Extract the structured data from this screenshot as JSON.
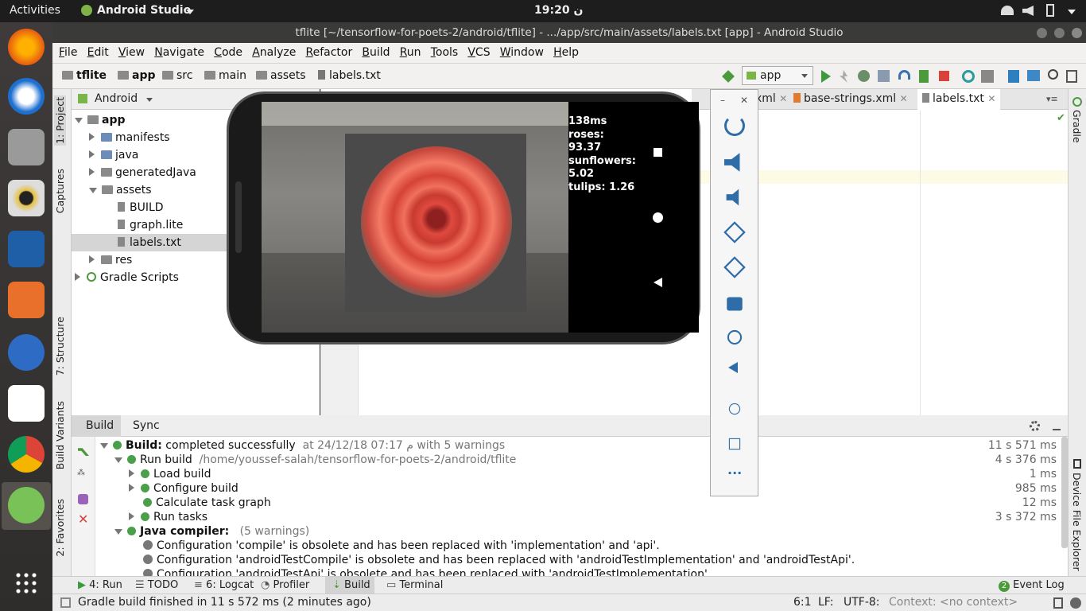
{
  "topbar": {
    "activities": "Activities",
    "app_name": "Android Studio",
    "clock": "ن 19:20"
  },
  "window": {
    "title": "tflite [~/tensorflow-for-poets-2/android/tflite] - .../app/src/main/assets/labels.txt [app] - Android Studio"
  },
  "menu": [
    "File",
    "Edit",
    "View",
    "Navigate",
    "Code",
    "Analyze",
    "Refactor",
    "Build",
    "Run",
    "Tools",
    "VCS",
    "Window",
    "Help"
  ],
  "breadcrumb": [
    "tflite",
    "app",
    "src",
    "main",
    "assets",
    "labels.txt"
  ],
  "run_config": "app",
  "left_tabs": [
    "1: Project",
    "Captures",
    "7: Structure",
    "Build Variants",
    "2: Favorites"
  ],
  "right_tabs": [
    "Gradle",
    "Device File Explorer"
  ],
  "project": {
    "view": "Android",
    "tree": [
      {
        "label": "app",
        "level": 0,
        "bold": true
      },
      {
        "label": "manifests",
        "level": 1
      },
      {
        "label": "java",
        "level": 1
      },
      {
        "label": "generatedJava",
        "level": 1
      },
      {
        "label": "assets",
        "level": 1
      },
      {
        "label": "BUILD",
        "level": 2
      },
      {
        "label": "graph.lite",
        "level": 2
      },
      {
        "label": "labels.txt",
        "level": 2,
        "selected": true
      },
      {
        "label": "res",
        "level": 1
      },
      {
        "label": "Gradle Scripts",
        "level": 0
      }
    ]
  },
  "editor_tabs": [
    "xml",
    "base-strings.xml",
    "labels.txt"
  ],
  "emulator": {
    "overlay": [
      "138ms",
      "roses: 93.37",
      "sunflowers:",
      "5.02",
      "tulips: 1.26"
    ]
  },
  "build": {
    "tabs": [
      "Build",
      "Sync"
    ],
    "lines": [
      {
        "text": "Build:",
        "rest": " completed successfully",
        "meta": "at 24/12/18 07:17 م  with 5 warnings",
        "time": "11 s 571 ms"
      },
      {
        "text": "Run build",
        "meta": "/home/youssef-salah/tensorflow-for-poets-2/android/tflite",
        "time": "4 s 376 ms"
      },
      {
        "text": "Load build",
        "time": "1 ms"
      },
      {
        "text": "Configure build",
        "time": "985 ms"
      },
      {
        "text": "Calculate task graph",
        "time": "12 ms"
      },
      {
        "text": "Run tasks",
        "time": "3 s 372 ms"
      },
      {
        "text": "Java compiler:",
        "meta": "(5 warnings)"
      },
      {
        "text": "Configuration 'compile' is obsolete and has been replaced with 'implementation' and 'api'."
      },
      {
        "text": "Configuration 'androidTestCompile' is obsolete and has been replaced with 'androidTestImplementation' and 'androidTestApi'."
      },
      {
        "text": "Configuration 'androidTestApi' is obsolete and has been replaced with 'androidTestImplementation'."
      }
    ]
  },
  "bottom_tabs": [
    "4: Run",
    "TODO",
    "6: Logcat",
    "Profiler",
    "Build",
    "Terminal",
    "Event Log"
  ],
  "event_count": "2",
  "status": {
    "message": "Gradle build finished in 11 s 572 ms (2 minutes ago)",
    "pos": "6:1",
    "lf": "LF:",
    "enc": "UTF-8:",
    "context": "Context: <no context>"
  }
}
